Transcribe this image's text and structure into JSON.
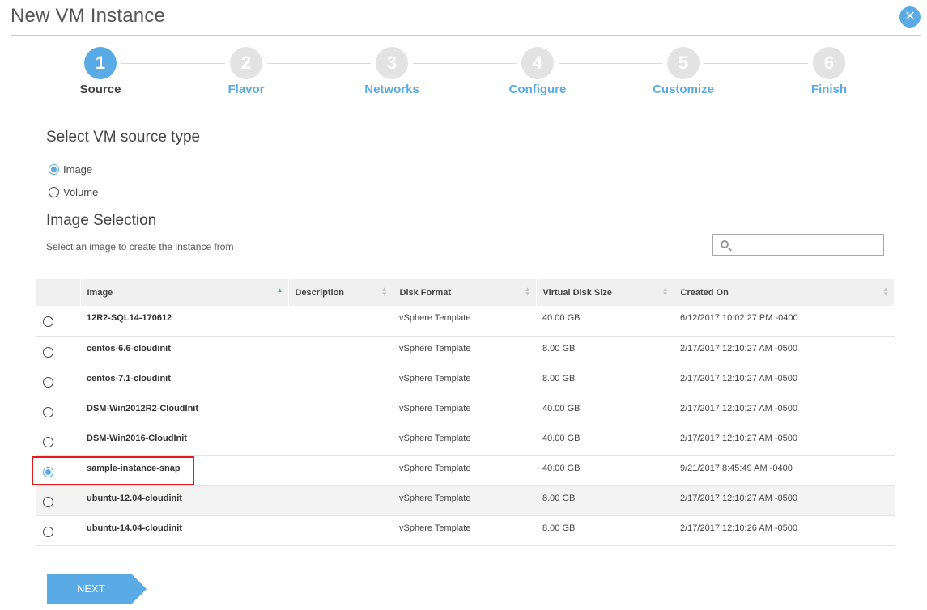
{
  "window": {
    "title": "New VM Instance",
    "close_icon": "close-icon"
  },
  "steps": [
    {
      "number": "1",
      "label": "Source",
      "active": true
    },
    {
      "number": "2",
      "label": "Flavor",
      "active": false
    },
    {
      "number": "3",
      "label": "Networks",
      "active": false
    },
    {
      "number": "4",
      "label": "Configure",
      "active": false
    },
    {
      "number": "5",
      "label": "Customize",
      "active": false
    },
    {
      "number": "6",
      "label": "Finish",
      "active": false
    }
  ],
  "source": {
    "heading": "Select VM source type",
    "options": [
      {
        "label": "Image",
        "selected": true
      },
      {
        "label": "Volume",
        "selected": false
      }
    ]
  },
  "image_selection": {
    "heading": "Image Selection",
    "subtext": "Select an image to create the instance from",
    "search": {
      "placeholder": "",
      "value": "",
      "icon": "search-icon"
    },
    "columns": [
      "Image",
      "Description",
      "Disk Format",
      "Virtual Disk Size",
      "Created On"
    ],
    "sort": {
      "column": "Image",
      "direction": "asc"
    },
    "rows": [
      {
        "image": "12R2-SQL14-170612",
        "description": "",
        "disk_format": "vSphere Template",
        "size": "40.00 GB",
        "created": "6/12/2017 10:02:27 PM -0400",
        "selected": false
      },
      {
        "image": "centos-6.6-cloudinit",
        "description": "",
        "disk_format": "vSphere Template",
        "size": "8.00 GB",
        "created": "2/17/2017 12:10:27 AM -0500",
        "selected": false
      },
      {
        "image": "centos-7.1-cloudinit",
        "description": "",
        "disk_format": "vSphere Template",
        "size": "8.00 GB",
        "created": "2/17/2017 12:10:27 AM -0500",
        "selected": false
      },
      {
        "image": "DSM-Win2012R2-CloudInit",
        "description": "",
        "disk_format": "vSphere Template",
        "size": "40.00 GB",
        "created": "2/17/2017 12:10:27 AM -0500",
        "selected": false
      },
      {
        "image": "DSM-Win2016-CloudInit",
        "description": "",
        "disk_format": "vSphere Template",
        "size": "40.00 GB",
        "created": "2/17/2017 12:10:27 AM -0500",
        "selected": false
      },
      {
        "image": "sample-instance-snap",
        "description": "",
        "disk_format": "vSphere Template",
        "size": "40.00 GB",
        "created": "9/21/2017 8:45:49 AM -0400",
        "selected": true
      },
      {
        "image": "ubuntu-12.04-cloudinit",
        "description": "",
        "disk_format": "vSphere Template",
        "size": "8.00 GB",
        "created": "2/17/2017 12:10:27 AM -0500",
        "selected": false
      },
      {
        "image": "ubuntu-14.04-cloudinit",
        "description": "",
        "disk_format": "vSphere Template",
        "size": "8.00 GB",
        "created": "2/17/2017 12:10:26 AM -0500",
        "selected": false
      }
    ]
  },
  "actions": {
    "next_label": "NEXT"
  },
  "colors": {
    "accent": "#5aaae6",
    "highlight": "#e21b1b",
    "sort_active": "#3cb39e"
  }
}
